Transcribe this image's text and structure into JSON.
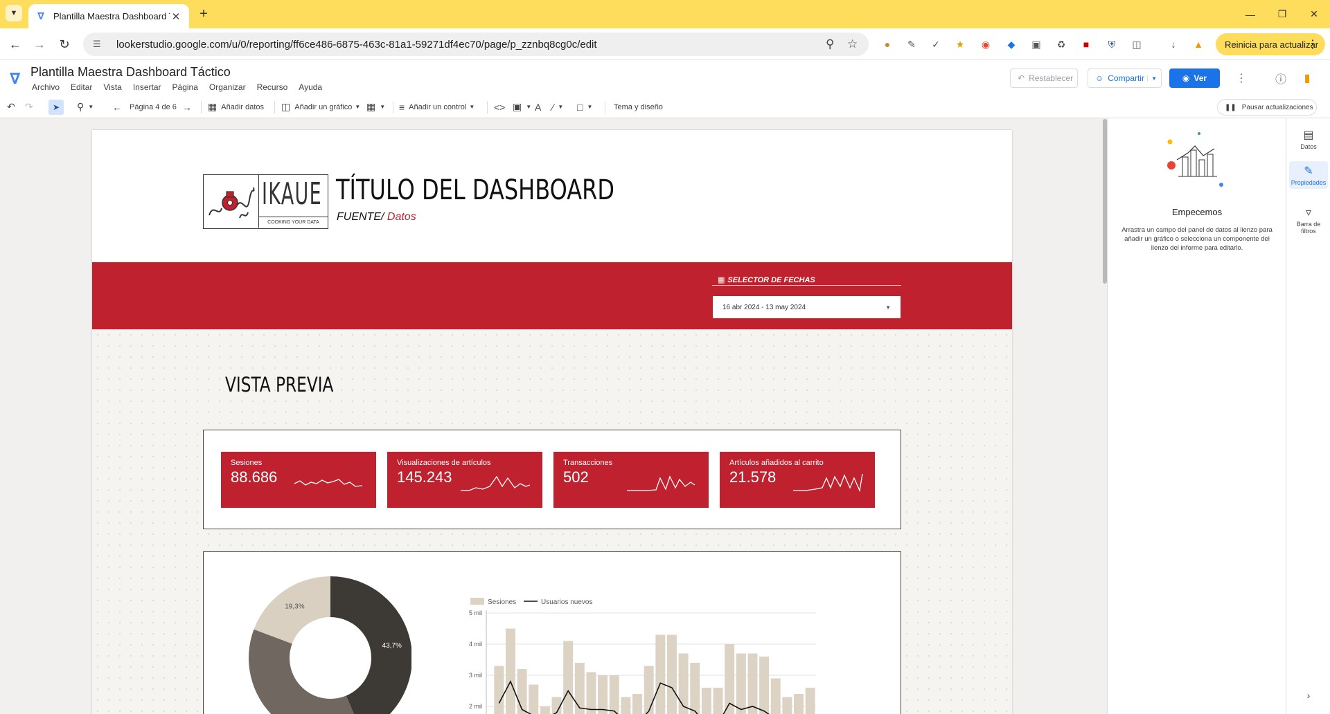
{
  "browser": {
    "tab_title": "Plantilla Maestra Dashboard Tá",
    "url": "lookerstudio.google.com/u/0/reporting/ff6ce486-6875-463c-81a1-59271df4ec70/page/p_zznbq8cg0c/edit",
    "update_label": "Reinicia para actualizar"
  },
  "app": {
    "doc_title": "Plantilla Maestra Dashboard Táctico",
    "menus": [
      "Archivo",
      "Editar",
      "Vista",
      "Insertar",
      "Página",
      "Organizar",
      "Recurso",
      "Ayuda"
    ],
    "reset_label": "Restablecer",
    "share_label": "Compartir",
    "view_label": "Ver"
  },
  "toolbar": {
    "page_label": "Página 4 de 6",
    "add_data": "Añadir datos",
    "add_chart": "Añadir un gráfico",
    "add_control": "Añadir un control",
    "theme": "Tema y diseño",
    "pause": "Pausar actualizaciones"
  },
  "report": {
    "logo_word": "IKAUE",
    "logo_tag": "COOKING YOUR DATA",
    "title": "TÍTULO DEL DASHBOARD",
    "source_label": "FUENTE/",
    "source_value": "Datos",
    "date_selector_label": "SELECTOR DE FECHAS",
    "date_range": "16 abr 2024 - 13 may 2024",
    "section_title": "VISTA PREVIA",
    "kpis": [
      {
        "label": "Sesiones",
        "value": "88.686"
      },
      {
        "label": "Visualizaciones de artículos",
        "value": "145.243"
      },
      {
        "label": "Transacciones",
        "value": "502"
      },
      {
        "label": "Artículos añadidos al carrito",
        "value": "21.578"
      }
    ]
  },
  "chart_data": [
    {
      "type": "pie",
      "donut": true,
      "slices": [
        {
          "value": 43.7,
          "label": "43,7%",
          "color": "#3d3a36"
        },
        {
          "value": 37.0,
          "label": "",
          "color": "#6f6760"
        },
        {
          "value": 19.3,
          "label": "19,3%",
          "color": "#d9d0c2"
        }
      ]
    },
    {
      "type": "bar",
      "legend": [
        "Sesiones",
        "Usuarios nuevos"
      ],
      "legend_position": "top-left",
      "y_ticks": [
        "5 mil",
        "4 mil",
        "3 mil",
        "2 mil"
      ],
      "ylim_visible": [
        2000,
        5000
      ],
      "series": [
        {
          "name": "Sesiones",
          "type": "bar",
          "color": "#ddd3c5",
          "values": [
            3300,
            4500,
            3200,
            2700,
            2000,
            2300,
            4100,
            3400,
            3100,
            3000,
            3000,
            2300,
            2400,
            3300,
            4300,
            4300,
            3700,
            3400,
            2600,
            2600,
            4000,
            3700,
            3700,
            3600,
            2900,
            2300,
            2400,
            2600
          ]
        },
        {
          "name": "Usuarios nuevos",
          "type": "line",
          "color": "#111111",
          "values": [
            2100,
            2800,
            1900,
            1700,
            1600,
            1800,
            2500,
            1950,
            1900,
            1900,
            1850,
            1500,
            1450,
            1850,
            2750,
            2600,
            2000,
            1850,
            1400,
            1450,
            2100,
            1900,
            2000,
            1850,
            1600,
            1350,
            1300,
            1400
          ]
        }
      ]
    }
  ],
  "right_panel": {
    "title": "Empecemos",
    "text": "Arrastra un campo del panel de datos al lienzo para añadir un gráfico o selecciona un componente del lienzo del informe para editarlo.",
    "rail": [
      "Datos",
      "Propiedades",
      "Barra de filtros"
    ]
  }
}
